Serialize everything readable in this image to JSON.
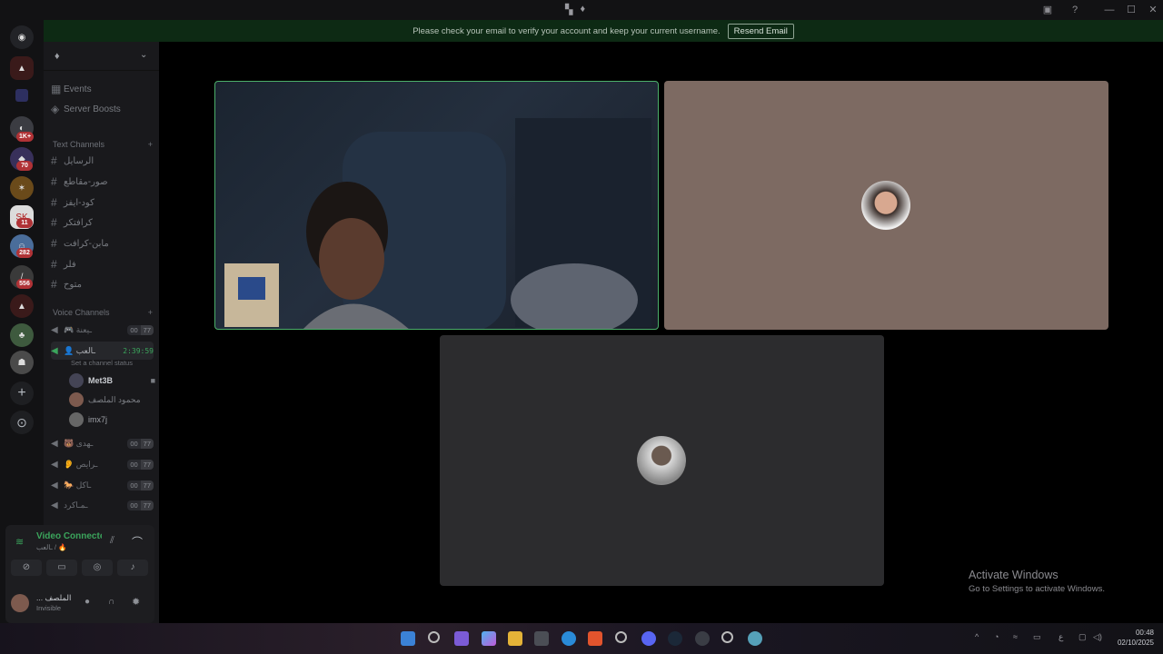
{
  "titlebar": {
    "center_icons": [
      "discord-mini-icon",
      "flame-icon"
    ]
  },
  "banner": {
    "message": "Please check your email to verify your account and keep your current username.",
    "button_label": "Resend Email"
  },
  "server_rail": {
    "badges": [
      "1K+",
      "70",
      "11",
      "282",
      "556"
    ]
  },
  "sidebar": {
    "server_name_icon": "flame-icon",
    "nav": [
      {
        "label": "Events",
        "icon": "calendar-icon"
      },
      {
        "label": "Server Boosts",
        "icon": "boost-icon"
      }
    ],
    "text_category": "Text Channels",
    "text_channels": [
      "الرسايل",
      "صور-مقاطع",
      "كود-ايفز",
      "كرافتكر",
      "مابن-كرافت",
      "فلر",
      "متوح"
    ],
    "voice_category": "Voice Channels",
    "voice_channels": [
      {
        "name": "🎮 ـيعنة",
        "count_a": "00",
        "count_b": "77"
      },
      {
        "name": "👤 ـالعب",
        "timer": "2:39:59",
        "status": "Set a channel status"
      },
      {
        "name": "🐻 ـهدى",
        "count_a": "00",
        "count_b": "77"
      },
      {
        "name": "👂 ـرايص",
        "count_a": "00",
        "count_b": "77"
      },
      {
        "name": "🐎 ـاكل",
        "count_a": "00",
        "count_b": "77"
      },
      {
        "name": "ـمـاكرد",
        "count_a": "00",
        "count_b": "77"
      }
    ],
    "members": [
      {
        "name": "Met3B"
      },
      {
        "name": "محمود الملصف"
      },
      {
        "name": "imx7j"
      }
    ]
  },
  "voice_panel": {
    "status": "Video Connected",
    "channel": "ـالعب / 🔥",
    "user_name": "... الملصف",
    "user_status": "Invisible"
  },
  "activate_windows": {
    "title": "Activate Windows",
    "subtitle": "Go to Settings to activate Windows."
  },
  "clock": {
    "time": "00:48",
    "date": "02/10/2025"
  },
  "tray": {
    "lang": "ع"
  },
  "colors": {
    "banner_bg": "#0d2a14",
    "speaking_border": "#4caf6a",
    "tile_brown": "#7d6a62",
    "tile_gray": "#2c2c2e"
  }
}
